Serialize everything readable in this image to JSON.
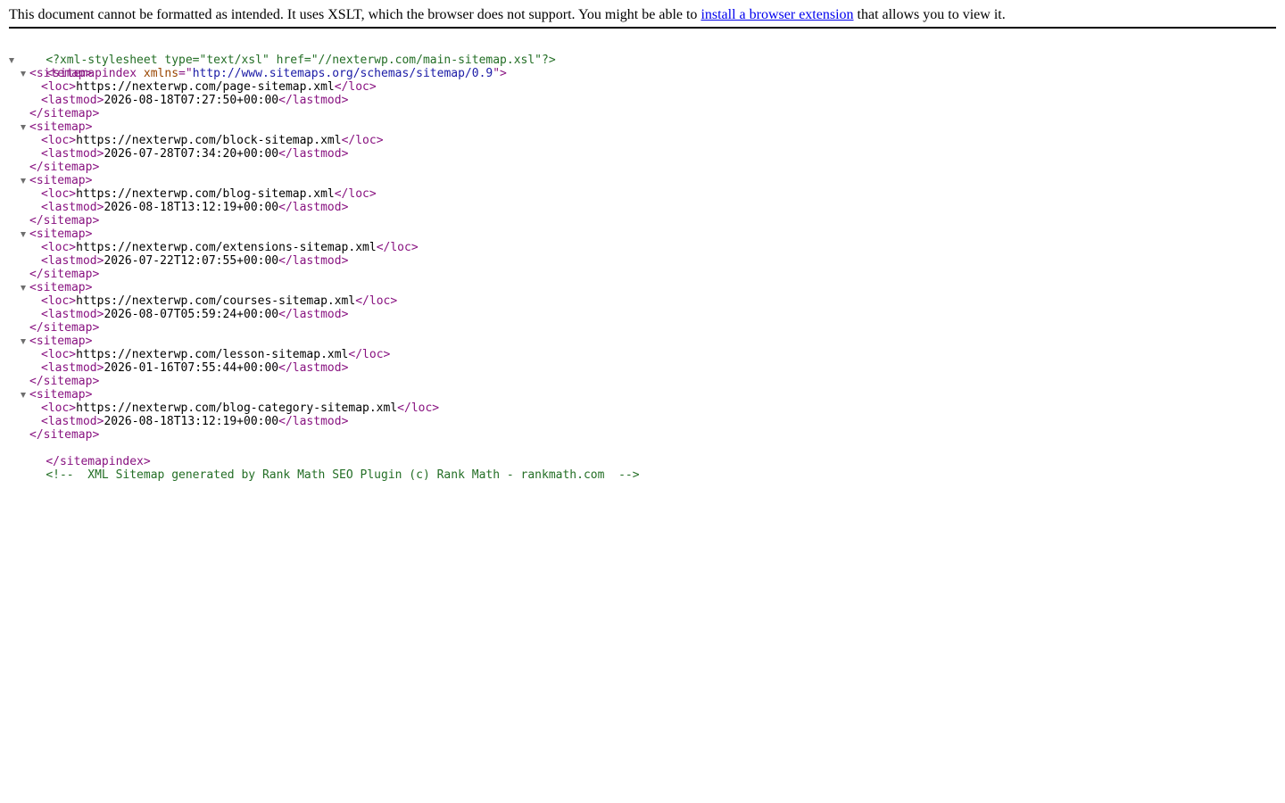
{
  "banner": {
    "text_before": "This document cannot be formatted as intended. It uses XSLT, which the browser does not support. You might be able to ",
    "link_text": "install a browser extension",
    "text_after": " that allows you to view it."
  },
  "xml": {
    "stylesheet_pi": "<?xml-stylesheet type=\"text/xsl\" href=\"//nexterwp.com/main-sitemap.xsl\"?>",
    "root_open_tag": "<sitemapindex",
    "root_attr_name": " xmlns",
    "root_attr_eq": "=\"",
    "root_attr_value": "http://www.sitemaps.org/schemas/sitemap/0.9",
    "root_attr_close": "\">",
    "root_close_tag": "</sitemapindex>",
    "sitemap_open": "<sitemap>",
    "sitemap_close": "</sitemap>",
    "loc_open": "<loc>",
    "loc_close": "</loc>",
    "lastmod_open": "<lastmod>",
    "lastmod_close": "</lastmod>",
    "comment": "<!--  XML Sitemap generated by Rank Math SEO Plugin (c) Rank Math - rankmath.com  -->",
    "sitemaps": [
      {
        "loc": "https://nexterwp.com/page-sitemap.xml",
        "lastmod": "2026-08-18T07:27:50+00:00"
      },
      {
        "loc": "https://nexterwp.com/block-sitemap.xml",
        "lastmod": "2026-07-28T07:34:20+00:00"
      },
      {
        "loc": "https://nexterwp.com/blog-sitemap.xml",
        "lastmod": "2026-08-18T13:12:19+00:00"
      },
      {
        "loc": "https://nexterwp.com/extensions-sitemap.xml",
        "lastmod": "2026-07-22T12:07:55+00:00"
      },
      {
        "loc": "https://nexterwp.com/courses-sitemap.xml",
        "lastmod": "2026-08-07T05:59:24+00:00"
      },
      {
        "loc": "https://nexterwp.com/lesson-sitemap.xml",
        "lastmod": "2026-01-16T07:55:44+00:00"
      },
      {
        "loc": "https://nexterwp.com/blog-category-sitemap.xml",
        "lastmod": "2026-08-18T13:12:19+00:00"
      }
    ]
  },
  "colors": {
    "tag": "#881280",
    "attribute_name": "#994500",
    "attribute_value": "#1a1aa6",
    "comment": "#236e25",
    "toggle_arrow": "#6e6e6e",
    "link": "#0000ee"
  },
  "icons": {
    "toggle": "triangle-down-icon"
  }
}
